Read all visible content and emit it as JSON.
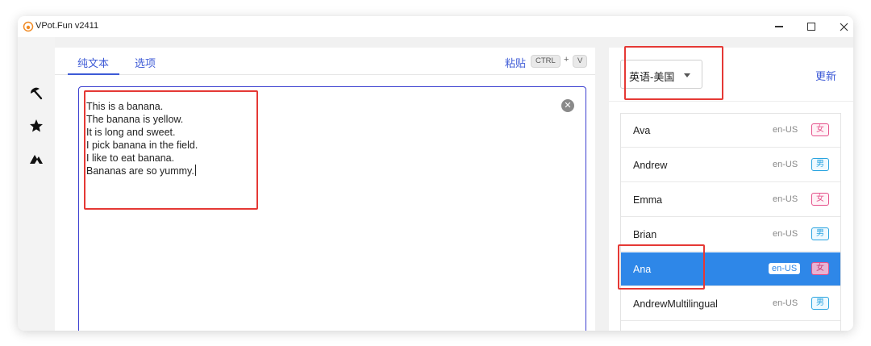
{
  "window": {
    "title": "VPot.Fun v2411"
  },
  "tabs": [
    {
      "label": "纯文本"
    },
    {
      "label": "选项"
    }
  ],
  "paste": {
    "label": "粘贴",
    "key1": "CTRL",
    "plus": "+",
    "key2": "V"
  },
  "editor": {
    "lines": [
      "This is a banana.",
      "The banana is yellow.",
      "It is long and sweet.",
      "I pick banana in the field.",
      "I like to eat banana.",
      "Bananas are so yummy."
    ],
    "clear_symbol": "✕"
  },
  "language": {
    "selected": "英语-美国"
  },
  "update": {
    "label": "更新"
  },
  "voices": [
    {
      "name": "Ava",
      "lang": "en-US",
      "gender": "女",
      "gender_type": "f"
    },
    {
      "name": "Andrew",
      "lang": "en-US",
      "gender": "男",
      "gender_type": "m"
    },
    {
      "name": "Emma",
      "lang": "en-US",
      "gender": "女",
      "gender_type": "f"
    },
    {
      "name": "Brian",
      "lang": "en-US",
      "gender": "男",
      "gender_type": "m"
    },
    {
      "name": "Ana",
      "lang": "en-US",
      "gender": "女",
      "gender_type": "f",
      "selected": true
    },
    {
      "name": "AndrewMultilingual",
      "lang": "en-US",
      "gender": "男",
      "gender_type": "m"
    }
  ],
  "rail_icons": [
    "umbrella-icon",
    "star-icon",
    "mountain-icon"
  ],
  "colors": {
    "accent": "#3d5ad6",
    "selected_row": "#2e87e8",
    "annotation": "#e53935"
  }
}
